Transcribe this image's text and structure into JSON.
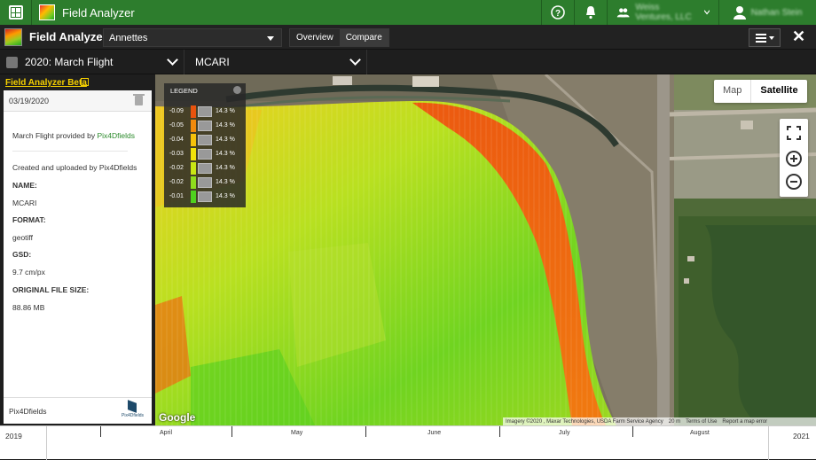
{
  "topbar": {
    "app_title": "Field Analyzer",
    "org_name": "Weiss Ventures, LLC",
    "user_name": "Nathan Stein"
  },
  "secondary": {
    "title": "Field Analyzer",
    "farm_value": "Annettes",
    "tabs": [
      "Overview",
      "Compare"
    ]
  },
  "flight_bar": {
    "flight_label": "2020: March Flight",
    "index_label": "MCARI"
  },
  "panel": {
    "beta_link": "Field Analyzer Beta",
    "date": "03/19/2020",
    "provided_text": "March Flight provided by ",
    "provider": "Pix4Dfields",
    "created_text": "Created and uploaded by Pix4Dfields",
    "name_label": "NAME:",
    "name_value": "MCARI",
    "format_label": "FORMAT:",
    "format_value": "geotiff",
    "gsd_label": "GSD:",
    "gsd_value": "9.7 cm/px",
    "size_label": "ORIGINAL FILE SIZE:",
    "size_value": "88.86 MB",
    "footer_label": "Pix4Dfields",
    "footer_logo_text": "Pix4Dfields"
  },
  "legend": {
    "title": "LEGEND",
    "rows": [
      {
        "value": "-0.09",
        "pct": "14.3 %",
        "color": "#e8530e"
      },
      {
        "value": "-0.05",
        "pct": "14.3 %",
        "color": "#f08a0c"
      },
      {
        "value": "-0.04",
        "pct": "14.3 %",
        "color": "#f7c20a"
      },
      {
        "value": "-0.03",
        "pct": "14.3 %",
        "color": "#f2e20a"
      },
      {
        "value": "-0.02",
        "pct": "14.3 %",
        "color": "#c9e614"
      },
      {
        "value": "-0.02",
        "pct": "14.3 %",
        "color": "#8fdc1c"
      },
      {
        "value": "-0.01",
        "pct": "14.3 %",
        "color": "#4fd21e"
      }
    ]
  },
  "map": {
    "type_options": [
      "Map",
      "Satellite"
    ],
    "selected_type": "Satellite",
    "google": "Google",
    "attribution": "Imagery ©2020 , Maxar Technologies, USDA Farm Service Agency",
    "scale": "20 m",
    "terms": "Terms of Use",
    "report": "Report a map error"
  },
  "timeline": {
    "start_year": "2019",
    "end_year": "2021",
    "months": [
      "April",
      "May",
      "June",
      "July",
      "August"
    ]
  }
}
